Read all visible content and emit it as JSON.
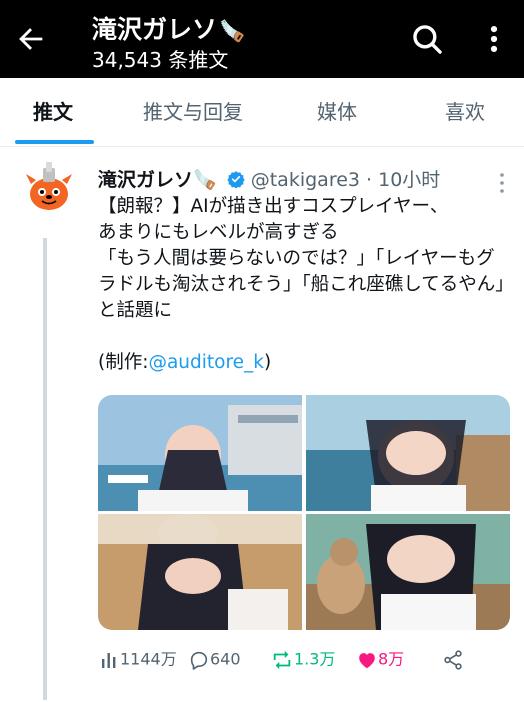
{
  "header": {
    "title": "滝沢ガレソ",
    "title_emoji": "🪚",
    "subtitle": "34,543 条推文"
  },
  "tabs": [
    {
      "label": "推文",
      "active": true
    },
    {
      "label": "推文与回复",
      "active": false
    },
    {
      "label": "媒体",
      "active": false
    },
    {
      "label": "喜欢",
      "active": false
    }
  ],
  "tweet": {
    "name": "滝沢ガレソ",
    "name_emoji": "🪚",
    "handle": "@takigare3",
    "separator": "·",
    "time": "10小时",
    "text": "【朗報？】AIが描き出すコスプレイヤー、\nあまりにもレベルが高すぎる\n「もう人間は要らないのでは？」「レイヤーもグラドルも淘汰されそう」「船これ座礁してるやん」と話題に",
    "credit_prefix": "(制作:",
    "credit_link": "@auditore_k",
    "credit_suffix": ")",
    "stats": {
      "views": "1144万",
      "replies": "640",
      "retweets": "1.3万",
      "likes": "8万"
    }
  },
  "colors": {
    "accent": "#1d9bf0",
    "retweet": "#00ba7c",
    "like": "#f91880",
    "topbar": "#000000"
  }
}
